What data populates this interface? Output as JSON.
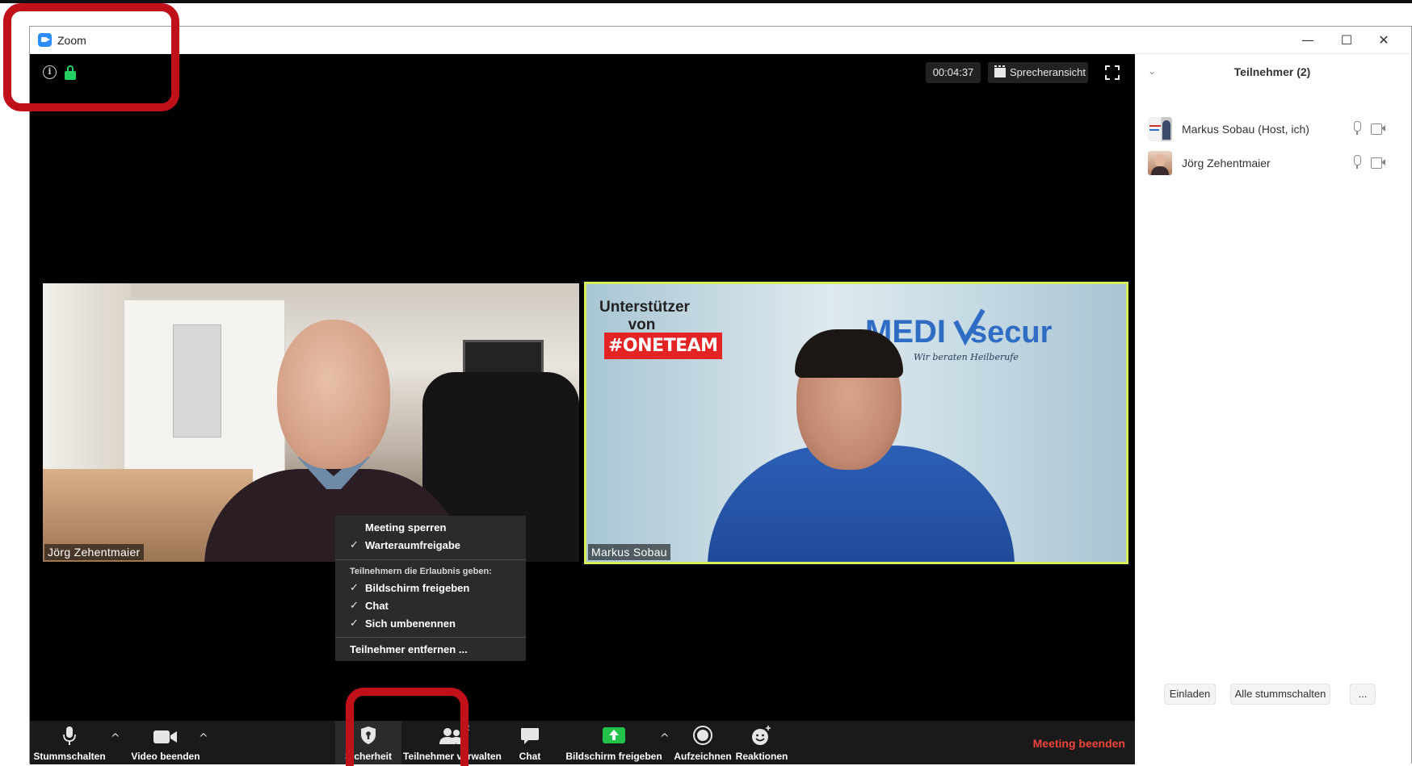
{
  "window": {
    "title": "Zoom",
    "minimize_glyph": "—",
    "maximize_glyph": "☐",
    "close_glyph": "✕"
  },
  "meeting": {
    "timer": "00:04:37",
    "view_label": "Sprecheransicht",
    "info_glyph": "i"
  },
  "videos": [
    {
      "name": "Jörg Zehentmaier"
    },
    {
      "name": "Markus Sobau",
      "overlay_caption_line1": "Unterstützer",
      "overlay_caption_line2": "von",
      "overlay_badge": "#ONETEAM",
      "logo_text_left": "MEDI",
      "logo_text_right": "secur",
      "logo_tagline": "Wir beraten Heilberufe"
    }
  ],
  "security_menu": {
    "items_top": [
      {
        "label": "Meeting sperren",
        "checked": false,
        "check": ""
      },
      {
        "label": "Warteraumfreigabe",
        "checked": true,
        "check": "✓"
      }
    ],
    "section_label": "Teilnehmern die Erlaubnis geben:",
    "items_allow": [
      {
        "label": "Bildschirm freigeben",
        "check": "✓"
      },
      {
        "label": "Chat",
        "check": "✓"
      },
      {
        "label": "Sich umbenennen",
        "check": "✓"
      }
    ],
    "remove_label": "Teilnehmer entfernen ..."
  },
  "toolbar": {
    "mute_label": "Stummschalten",
    "video_label": "Video beenden",
    "security_label": "Sicherheit",
    "participants_label": "Teilnehmer verwalten",
    "participants_count": "2",
    "chat_label": "Chat",
    "share_label": "Bildschirm freigeben",
    "record_label": "Aufzeichnen",
    "reactions_label": "Reaktionen",
    "end_label": "Meeting beenden",
    "caret_glyph": "^"
  },
  "participants_panel": {
    "title": "Teilnehmer (2)",
    "chevron_glyph": "⌄",
    "participants": [
      {
        "name": "Markus Sobau (Host, ich)"
      },
      {
        "name": "Jörg Zehentmaier"
      }
    ],
    "invite_label": "Einladen",
    "mute_all_label": "Alle stummschalten",
    "more_label": "..."
  },
  "colors": {
    "accent_blue": "#2d8cff",
    "lock_green": "#23d160",
    "end_red": "#f2453b",
    "highlight_red": "#c0111b",
    "speaker_border": "#d9ec5a"
  }
}
